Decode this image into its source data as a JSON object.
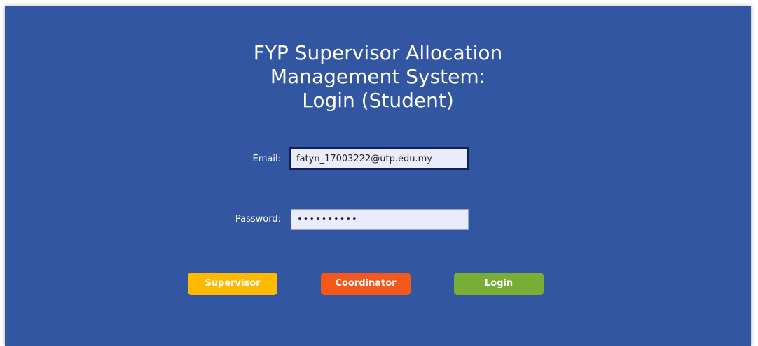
{
  "title": {
    "line1": "FYP Supervisor Allocation",
    "line2": "Management System:",
    "line3": "Login (Student)"
  },
  "form": {
    "email_label": "Email:",
    "email_value": "fatyn_17003222@utp.edu.my",
    "password_label": "Password:",
    "password_value": "••••••••••"
  },
  "buttons": {
    "supervisor": "Supervisor",
    "coordinator": "Coordinator",
    "login": "Login"
  },
  "colors": {
    "background": "#3356a2",
    "supervisor": "#ffba00",
    "coordinator": "#f4581b",
    "login": "#78ae36"
  }
}
